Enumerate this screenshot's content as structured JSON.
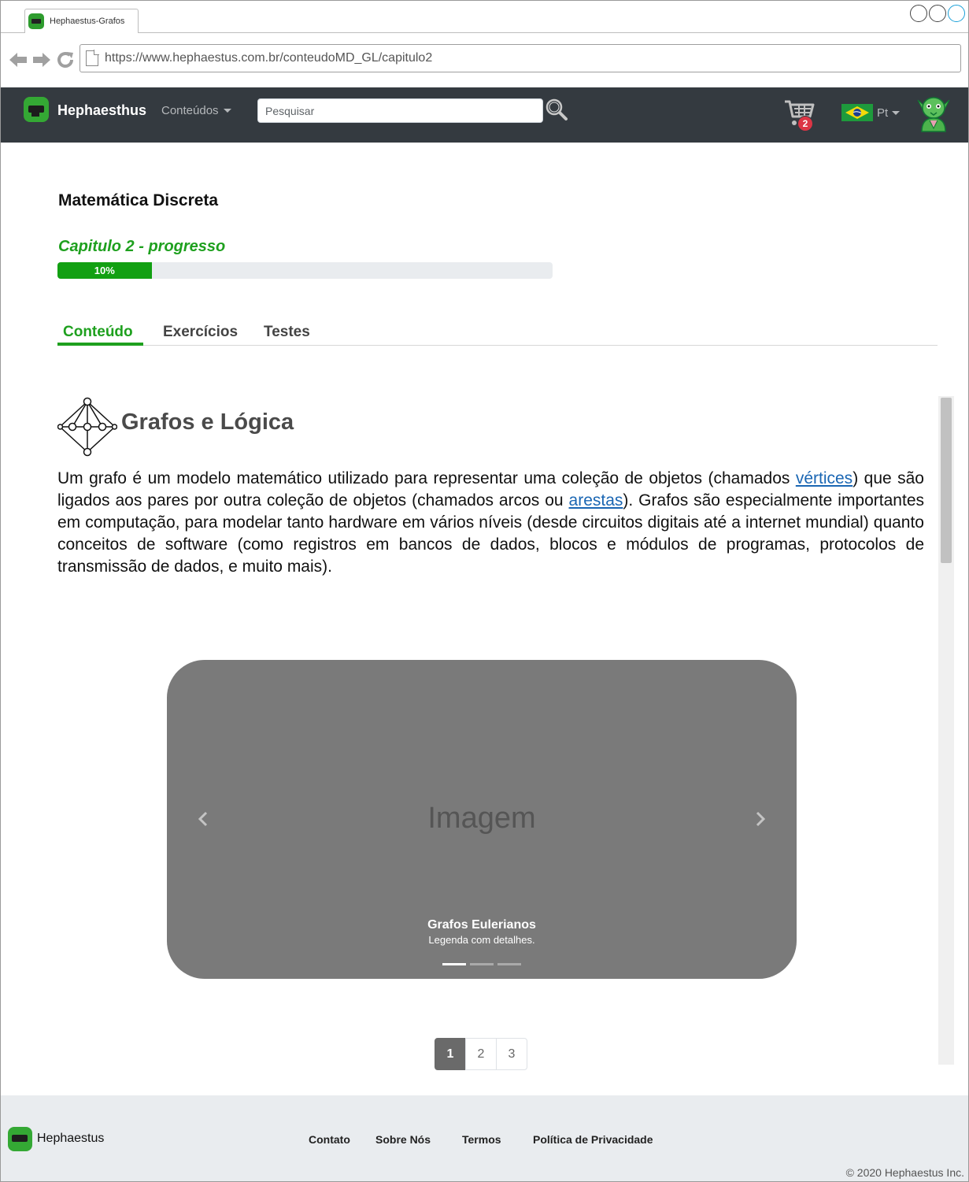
{
  "browser": {
    "tab_title": "Hephaestus-Grafos",
    "url": "https://www.hephaestus.com.br/conteudoMD_GL/capitulo2"
  },
  "navbar": {
    "brand": "Hephaesthus",
    "contents_menu": "Conteúdos",
    "search_placeholder": "Pesquisar",
    "cart_count": "2",
    "language": "Pt"
  },
  "course": {
    "title": "Matemática Discreta",
    "chapter_label": "Capitulo 2 - progresso",
    "progress_percent": 10,
    "progress_label": "10%"
  },
  "tabs": [
    {
      "label": "Conteúdo",
      "active": true
    },
    {
      "label": "Exercícios",
      "active": false
    },
    {
      "label": "Testes",
      "active": false
    }
  ],
  "section": {
    "title": "Grafos e Lógica",
    "paragraph": {
      "part1": "Um grafo é um modelo matemático utilizado para representar uma coleção de objetos (chamados ",
      "link1": "vértices",
      "part2": ") que são ligados aos pares por outra coleção de objetos (chamados arcos ou ",
      "link2": "arestas",
      "part3": "). Grafos são especialmente importantes em computação, para modelar tanto hardware em vários níveis (desde circuitos digitais até a internet mundial) quanto conceitos de software (como registros em bancos de dados, blocos e módulos de programas, protocolos de transmissão de dados, e muito mais)."
    }
  },
  "carousel": {
    "placeholder": "Imagem",
    "caption_title": "Grafos Eulerianos",
    "caption_text": "Legenda com detalhes.",
    "slide_count": 3,
    "active_slide": 1
  },
  "pagination": [
    "1",
    "2",
    "3"
  ],
  "footer": {
    "brand": "Hephaestus",
    "links": [
      "Contato",
      "Sobre Nós",
      "Termos",
      "Política de Privacidade"
    ],
    "copyright": "© 2020 Hephaestus Inc."
  },
  "colors": {
    "accent": "#1ea01e",
    "navbar_bg": "#343a40",
    "badge": "#dc3545",
    "link": "#1a66b3"
  },
  "icons": [
    "back-arrow-icon",
    "forward-arrow-icon",
    "reload-icon",
    "page-icon",
    "search-icon",
    "cart-icon",
    "brazil-flag-icon",
    "user-avatar-icon",
    "graph-icon",
    "chevron-left-icon",
    "chevron-right-icon"
  ]
}
